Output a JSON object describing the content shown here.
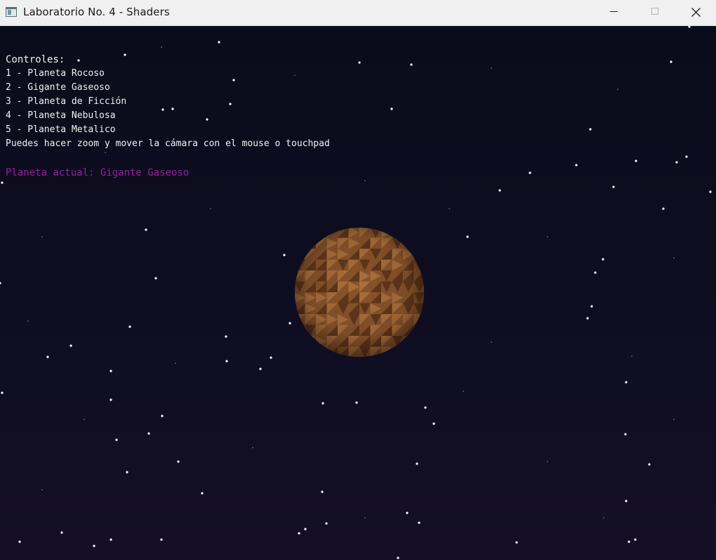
{
  "window": {
    "title": "Laboratorio No. 4 - Shaders",
    "icon": "app-window-icon",
    "buttons": [
      "minimize",
      "maximize",
      "close"
    ]
  },
  "hud": {
    "heading": "Controles:",
    "controls": [
      "1 - Planeta Rocoso",
      "2 - Gigante Gaseoso",
      "3 - Planeta de Ficción",
      "4 - Planeta Nebulosa",
      "5 - Planeta Metalico"
    ],
    "hint": "Puedes hacer zoom y mover la cámara con el mouse o touchpad",
    "current_planet": "Planeta actual: Gigante Gaseoso"
  },
  "colors": {
    "background": "#0b0a1a",
    "hud_text": "#f2f2f2",
    "current_planet_text": "#9a1ea0",
    "planet_base": "#8a542b",
    "planet_light": "#b0743e",
    "planet_dark": "#5a3218"
  }
}
